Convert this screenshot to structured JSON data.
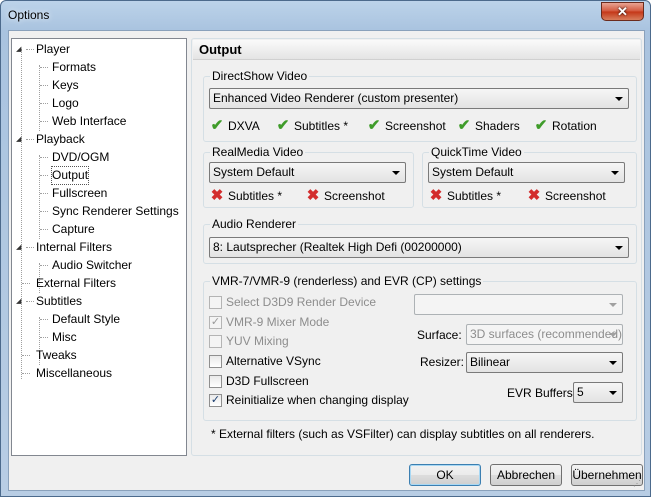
{
  "window": {
    "title": "Options",
    "close_symbol": "✕"
  },
  "tree": {
    "items": [
      {
        "label": "Player"
      },
      {
        "label": "Formats"
      },
      {
        "label": "Keys"
      },
      {
        "label": "Logo"
      },
      {
        "label": "Web Interface"
      },
      {
        "label": "Playback"
      },
      {
        "label": "DVD/OGM"
      },
      {
        "label": "Output"
      },
      {
        "label": "Fullscreen"
      },
      {
        "label": "Sync Renderer Settings"
      },
      {
        "label": "Capture"
      },
      {
        "label": "Internal Filters"
      },
      {
        "label": "Audio Switcher"
      },
      {
        "label": "External Filters"
      },
      {
        "label": "Subtitles"
      },
      {
        "label": "Default Style"
      },
      {
        "label": "Misc"
      },
      {
        "label": "Tweaks"
      },
      {
        "label": "Miscellaneous"
      }
    ],
    "selected": "Output"
  },
  "panel": {
    "title": "Output",
    "directshow": {
      "label": "DirectShow Video",
      "renderer": "Enhanced Video Renderer (custom presenter)",
      "features": [
        "DXVA",
        "Subtitles *",
        "Screenshot",
        "Shaders",
        "Rotation"
      ]
    },
    "realmedia": {
      "label": "RealMedia Video",
      "renderer": "System Default",
      "features": [
        "Subtitles *",
        "Screenshot"
      ]
    },
    "quicktime": {
      "label": "QuickTime Video",
      "renderer": "System Default",
      "features": [
        "Subtitles *",
        "Screenshot"
      ]
    },
    "audio": {
      "label": "Audio Renderer",
      "renderer": "8: Lautsprecher (Realtek High Defi (00200000)"
    },
    "vmr": {
      "label": "VMR-7/VMR-9 (renderless) and EVR (CP) settings",
      "select_d3d9": "Select D3D9 Render Device",
      "d3d9_device": "",
      "vmr9_mixer": "VMR-9 Mixer Mode",
      "yuv_mixing": "YUV Mixing",
      "alt_vsync": "Alternative VSync",
      "d3d_fullscreen": "D3D Fullscreen",
      "reinit": "Reinitialize when changing display",
      "surface_label": "Surface:",
      "surface_value": "3D surfaces (recommended)",
      "resizer_label": "Resizer:",
      "resizer_value": "Bilinear",
      "evr_label": "EVR Buffers:",
      "evr_value": "5"
    },
    "footnote": "* External filters (such as VSFilter) can display subtitles on all renderers."
  },
  "buttons": {
    "ok": "OK",
    "cancel": "Abbrechen",
    "apply": "Übernehmen"
  },
  "icons": {
    "supported": "check-icon",
    "unsupported": "cross-icon"
  },
  "colors": {
    "check": "#3f9c2a",
    "cross": "#d32d2d",
    "titlebar": "#b8cde4"
  }
}
